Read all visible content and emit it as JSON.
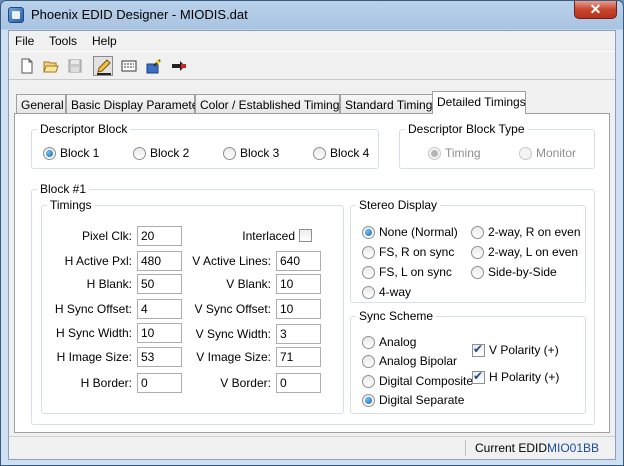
{
  "window": {
    "title": "Phoenix EDID Designer - MIODIS.dat",
    "close_glyph": "✕"
  },
  "menu": [
    "File",
    "Tools",
    "Help"
  ],
  "toolbar": [
    "new-file-icon",
    "open-folder-icon",
    "save-disk-icon",
    "edit-pencil-icon",
    "keyboard-table-icon",
    "wizard-icon",
    "export-arrow-icon"
  ],
  "tabs": [
    "General",
    "Basic Display Parameters",
    "Color /  Established Timings",
    "Standard Timings",
    "Detailed Timings"
  ],
  "descriptor_block": {
    "label": "Descriptor Block",
    "options": [
      "Block 1",
      "Block 2",
      "Block 3",
      "Block 4"
    ],
    "selected": "Block 1"
  },
  "descriptor_block_type": {
    "label": "Descriptor Block Type",
    "options": [
      "Timing",
      "Monitor"
    ],
    "selected": "Timing"
  },
  "block": {
    "label": "Block #1"
  },
  "timings": {
    "label": "Timings",
    "pixel_clk": {
      "label": "Pixel Clk:",
      "value": "20"
    },
    "interlaced": {
      "label": "Interlaced",
      "checked": false
    },
    "h_active": {
      "label": "H Active Pxl:",
      "value": "480"
    },
    "v_active": {
      "label": "V Active Lines:",
      "value": "640"
    },
    "h_blank": {
      "label": "H Blank:",
      "value": "50"
    },
    "v_blank": {
      "label": "V Blank:",
      "value": "10"
    },
    "h_sync_offset": {
      "label": "H Sync Offset:",
      "value": "4"
    },
    "v_sync_offset": {
      "label": "V Sync Offset:",
      "value": "10"
    },
    "h_sync_width": {
      "label": "H Sync Width:",
      "value": "10"
    },
    "v_sync_width": {
      "label": "V Sync Width:",
      "value": "3"
    },
    "h_image_size": {
      "label": "H Image Size:",
      "value": "53"
    },
    "v_image_size": {
      "label": "V Image Size:",
      "value": "71"
    },
    "h_border": {
      "label": "H Border:",
      "value": "0"
    },
    "v_border": {
      "label": "V Border:",
      "value": "0"
    }
  },
  "stereo_display": {
    "label": "Stereo Display",
    "options": [
      "None (Normal)",
      "FS, R on sync",
      "FS, L on sync",
      "4-way",
      "2-way, R on even",
      "2-way, L on even",
      "Side-by-Side"
    ],
    "selected": "None (Normal)"
  },
  "sync_scheme": {
    "label": "Sync Scheme",
    "options": [
      "Analog",
      "Analog Bipolar",
      "Digital Composite",
      "Digital Separate"
    ],
    "selected": "Digital Separate",
    "v_polarity": {
      "label": "V Polarity (+)",
      "checked": true
    },
    "h_polarity": {
      "label": "H Polarity (+)",
      "checked": true
    }
  },
  "status": {
    "label": "Current EDID:",
    "value": "MIO01BB"
  },
  "colors": {
    "title_bar": "#b9d1ea",
    "selected_radio": "#1a5fb0",
    "status_value": "#1a4fa0"
  }
}
